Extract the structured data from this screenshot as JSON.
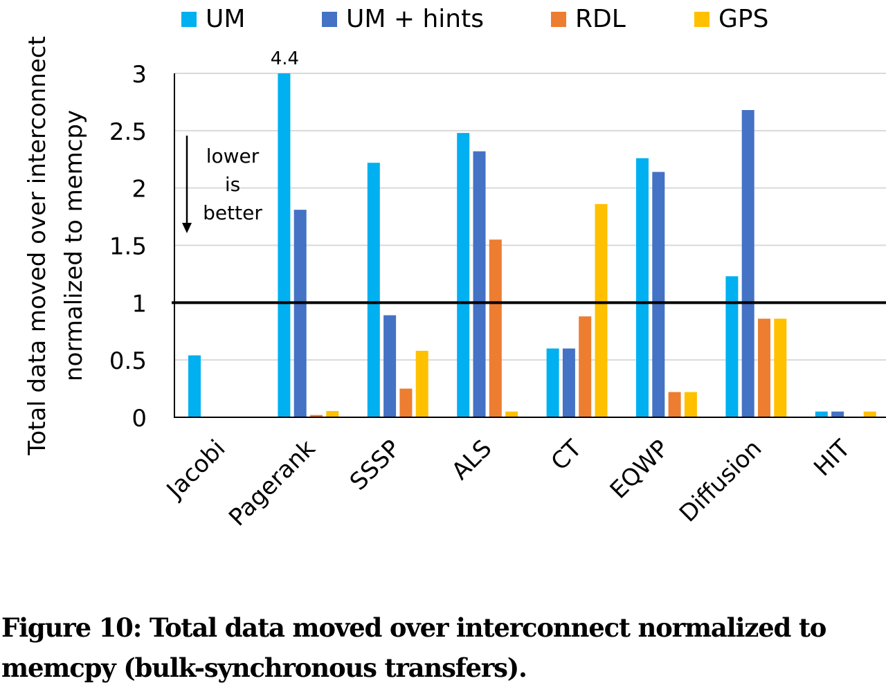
{
  "chart_data": {
    "type": "bar",
    "title": "",
    "xlabel": "",
    "ylabel": "Total data moved over interconnect normalized to memcpy",
    "ylabel_lines": [
      "Total data moved over interconnect",
      "normalized to memcpy"
    ],
    "ylim": [
      0,
      3
    ],
    "yticks": [
      0,
      0.5,
      1,
      1.5,
      2,
      2.5,
      3
    ],
    "ytick_labels": [
      "0",
      "0.5",
      "1",
      "1.5",
      "2",
      "2.5",
      "3"
    ],
    "grid": true,
    "legend_position": "top",
    "reference_line": 1,
    "categories": [
      "Jacobi",
      "Pagerank",
      "SSSP",
      "ALS",
      "CT",
      "EQWP",
      "Diffusion",
      "HIT"
    ],
    "series": [
      {
        "name": "UM",
        "color": "#00B0F0",
        "values": [
          0.54,
          4.4,
          2.22,
          2.48,
          0.6,
          2.26,
          1.23,
          0.05
        ]
      },
      {
        "name": "UM + hints",
        "color": "#4472C4",
        "values": [
          0.0,
          1.81,
          0.89,
          2.32,
          0.6,
          2.14,
          2.68,
          0.05
        ]
      },
      {
        "name": "RDL",
        "color": "#ED7D31",
        "values": [
          0.0,
          0.02,
          0.25,
          1.55,
          0.88,
          0.22,
          0.86,
          0.005
        ]
      },
      {
        "name": "GPS",
        "color": "#FFC000",
        "values": [
          0.0,
          0.055,
          0.58,
          0.05,
          1.86,
          0.22,
          0.86,
          0.05
        ]
      }
    ],
    "annotations": [
      {
        "text": "4.4",
        "category": "Pagerank",
        "series": "UM",
        "note": "bar clipped at axis max"
      },
      {
        "text_lines": [
          "lower",
          "is",
          "better"
        ],
        "arrow": "down"
      }
    ]
  },
  "caption": {
    "label": "Figure 10:",
    "text": "Total data moved over interconnect normalized to memcpy (bulk-synchronous transfers)."
  }
}
